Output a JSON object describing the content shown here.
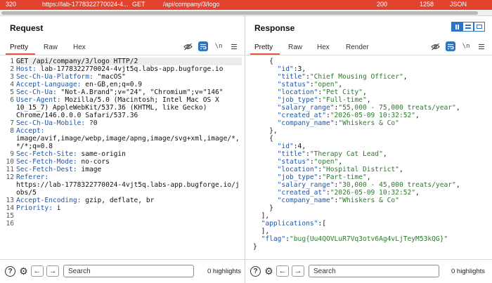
{
  "history_row": {
    "id": "320",
    "host": "https://lab-1778322770024-4...",
    "method": "GET",
    "path": "/api/company/3/logo",
    "status": "200",
    "length": "1258",
    "mime": "JSON"
  },
  "request": {
    "title": "Request",
    "tabs": [
      "Pretty",
      "Raw",
      "Hex"
    ],
    "active_tab": "Pretty",
    "line_numbers": [
      "1",
      "2",
      "3",
      "4",
      "5",
      "6",
      "",
      "",
      "7",
      "8",
      "",
      "",
      "9",
      "10",
      "11",
      "12",
      "",
      "",
      "13",
      "14",
      "15",
      "16"
    ],
    "lines": [
      {
        "name": "",
        "value": "GET /api/company/3/logo HTTP/2"
      },
      {
        "name": "Host:",
        "value": " lab-1778322770024-4vjt5q.labs-app.bugforge.io"
      },
      {
        "name": "Sec-Ch-Ua-Platform:",
        "value": " \"macOS\""
      },
      {
        "name": "Accept-Language:",
        "value": " en-GB,en;q=0.9"
      },
      {
        "name": "Sec-Ch-Ua:",
        "value": " \"Not-A.Brand\";v=\"24\", \"Chromium\";v=\"146\""
      },
      {
        "name": "User-Agent:",
        "value": " Mozilla/5.0 (Macintosh; Intel Mac OS X"
      },
      {
        "name": "",
        "value": "10_15_7) AppleWebKit/537.36 (KHTML, like Gecko)"
      },
      {
        "name": "",
        "value": "Chrome/146.0.0.0 Safari/537.36"
      },
      {
        "name": "Sec-Ch-Ua-Mobile:",
        "value": " ?0"
      },
      {
        "name": "Accept:",
        "value": ""
      },
      {
        "name": "",
        "value": "image/avif,image/webp,image/apng,image/svg+xml,image/*,"
      },
      {
        "name": "",
        "value": "*/*;q=0.8"
      },
      {
        "name": "Sec-Fetch-Site:",
        "value": " same-origin"
      },
      {
        "name": "Sec-Fetch-Mode:",
        "value": " no-cors"
      },
      {
        "name": "Sec-Fetch-Dest:",
        "value": " image"
      },
      {
        "name": "Referer:",
        "value": ""
      },
      {
        "name": "",
        "value": "https://lab-1778322770024-4vjt5q.labs-app.bugforge.io/j"
      },
      {
        "name": "",
        "value": "obs/5"
      },
      {
        "name": "Accept-Encoding:",
        "value": " gzip, deflate, br"
      },
      {
        "name": "Priority:",
        "value": " i"
      },
      {
        "name": "",
        "value": ""
      },
      {
        "name": "",
        "value": ""
      }
    ],
    "search_placeholder": "Search",
    "highlights": "0 highlights"
  },
  "response": {
    "title": "Response",
    "tabs": [
      "Pretty",
      "Raw",
      "Hex",
      "Render"
    ],
    "active_tab": "Pretty",
    "lines": [
      {
        "indent": "    ",
        "parts": [
          [
            "p",
            "{"
          ]
        ]
      },
      {
        "indent": "      ",
        "parts": [
          [
            "k",
            "\"id\""
          ],
          [
            "p",
            ":3,"
          ]
        ]
      },
      {
        "indent": "      ",
        "parts": [
          [
            "k",
            "\"title\""
          ],
          [
            "p",
            ":"
          ],
          [
            "s",
            "\"Chief Mousing Officer\""
          ],
          [
            "p",
            ","
          ]
        ]
      },
      {
        "indent": "      ",
        "parts": [
          [
            "k",
            "\"status\""
          ],
          [
            "p",
            ":"
          ],
          [
            "s",
            "\"open\""
          ],
          [
            "p",
            ","
          ]
        ]
      },
      {
        "indent": "      ",
        "parts": [
          [
            "k",
            "\"location\""
          ],
          [
            "p",
            ":"
          ],
          [
            "s",
            "\"Pet City\""
          ],
          [
            "p",
            ","
          ]
        ]
      },
      {
        "indent": "      ",
        "parts": [
          [
            "k",
            "\"job_type\""
          ],
          [
            "p",
            ":"
          ],
          [
            "s",
            "\"Full-time\""
          ],
          [
            "p",
            ","
          ]
        ]
      },
      {
        "indent": "      ",
        "parts": [
          [
            "k",
            "\"salary_range\""
          ],
          [
            "p",
            ":"
          ],
          [
            "s",
            "\"55,000 - 75,000 treats/year\""
          ],
          [
            "p",
            ","
          ]
        ]
      },
      {
        "indent": "      ",
        "parts": [
          [
            "k",
            "\"created_at\""
          ],
          [
            "p",
            ":"
          ],
          [
            "s",
            "\"2026-05-09 10:32:52\""
          ],
          [
            "p",
            ","
          ]
        ]
      },
      {
        "indent": "      ",
        "parts": [
          [
            "k",
            "\"company_name\""
          ],
          [
            "p",
            ":"
          ],
          [
            "s",
            "\"Whiskers & Co\""
          ]
        ]
      },
      {
        "indent": "    ",
        "parts": [
          [
            "p",
            "},"
          ]
        ]
      },
      {
        "indent": "    ",
        "parts": [
          [
            "p",
            "{"
          ]
        ]
      },
      {
        "indent": "      ",
        "parts": [
          [
            "k",
            "\"id\""
          ],
          [
            "p",
            ":4,"
          ]
        ]
      },
      {
        "indent": "      ",
        "parts": [
          [
            "k",
            "\"title\""
          ],
          [
            "p",
            ":"
          ],
          [
            "s",
            "\"Therapy Cat Lead\""
          ],
          [
            "p",
            ","
          ]
        ]
      },
      {
        "indent": "      ",
        "parts": [
          [
            "k",
            "\"status\""
          ],
          [
            "p",
            ":"
          ],
          [
            "s",
            "\"open\""
          ],
          [
            "p",
            ","
          ]
        ]
      },
      {
        "indent": "      ",
        "parts": [
          [
            "k",
            "\"location\""
          ],
          [
            "p",
            ":"
          ],
          [
            "s",
            "\"Hospital District\""
          ],
          [
            "p",
            ","
          ]
        ]
      },
      {
        "indent": "      ",
        "parts": [
          [
            "k",
            "\"job_type\""
          ],
          [
            "p",
            ":"
          ],
          [
            "s",
            "\"Part-time\""
          ],
          [
            "p",
            ","
          ]
        ]
      },
      {
        "indent": "      ",
        "parts": [
          [
            "k",
            "\"salary_range\""
          ],
          [
            "p",
            ":"
          ],
          [
            "s",
            "\"30,000 - 45,000 treats/year\""
          ],
          [
            "p",
            ","
          ]
        ]
      },
      {
        "indent": "      ",
        "parts": [
          [
            "k",
            "\"created_at\""
          ],
          [
            "p",
            ":"
          ],
          [
            "s",
            "\"2026-05-09 10:32:52\""
          ],
          [
            "p",
            ","
          ]
        ]
      },
      {
        "indent": "      ",
        "parts": [
          [
            "k",
            "\"company_name\""
          ],
          [
            "p",
            ":"
          ],
          [
            "s",
            "\"Whiskers & Co\""
          ]
        ]
      },
      {
        "indent": "    ",
        "parts": [
          [
            "p",
            "}"
          ]
        ]
      },
      {
        "indent": "  ",
        "parts": [
          [
            "p",
            "],"
          ]
        ]
      },
      {
        "indent": "  ",
        "parts": [
          [
            "k",
            "\"applications\""
          ],
          [
            "p",
            ":["
          ]
        ]
      },
      {
        "indent": "  ",
        "parts": [
          [
            "p",
            "],"
          ]
        ]
      },
      {
        "indent": "  ",
        "parts": [
          [
            "k",
            "\"flag\""
          ],
          [
            "p",
            ":"
          ],
          [
            "s",
            "\"bug{Uu4QOVLuR7Vq3otv6Ag4vLjTeyM53kQG}\""
          ]
        ]
      },
      {
        "indent": "",
        "parts": [
          [
            "p",
            "}"
          ]
        ]
      }
    ],
    "search_placeholder": "Search",
    "highlights": "0 highlights"
  },
  "icons": {
    "eye_off": "eye-off-icon",
    "wrap": "wrap-icon",
    "newline": "\\n",
    "menu": "menu-icon"
  },
  "colors": {
    "accent": "#e8573a",
    "selected_row": "#e1432e",
    "toggle_blue": "#2b74c4"
  }
}
